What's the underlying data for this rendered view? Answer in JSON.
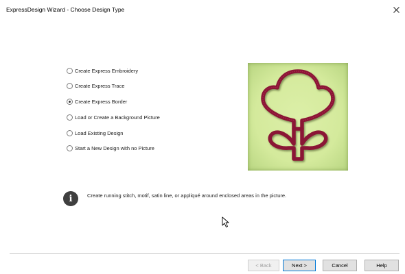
{
  "window": {
    "title": "ExpressDesign Wizard - Choose Design Type",
    "close_icon": "close-icon"
  },
  "options": [
    {
      "label": "Create Express Embroidery",
      "selected": false
    },
    {
      "label": "Create Express Trace",
      "selected": false
    },
    {
      "label": "Create Express Border",
      "selected": true
    },
    {
      "label": "Load or Create a Background Picture",
      "selected": false
    },
    {
      "label": "Load Existing Design",
      "selected": false
    },
    {
      "label": "Start a New Design with no Picture",
      "selected": false
    }
  ],
  "info": {
    "icon": "info-icon",
    "glyph": "i",
    "text": "Create running stitch, motif, satin line, or appliqué around enclosed areas in the picture."
  },
  "buttons": {
    "back": "< Back",
    "next": "Next >",
    "cancel": "Cancel",
    "help": "Help"
  },
  "colors": {
    "preview_background": "#d4ea9c",
    "stitch_outline": "#8a1236",
    "default_button_border": "#0078d7"
  }
}
